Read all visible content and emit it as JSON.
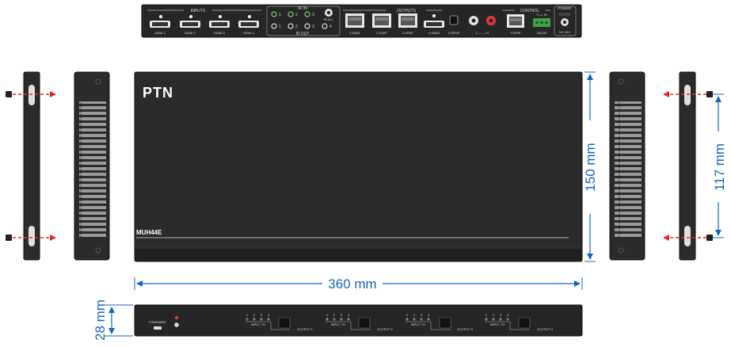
{
  "brand": "PTN",
  "model": "MUH44E",
  "dimensions": {
    "width": "360 mm",
    "depth": "150 mm",
    "height": "28 mm",
    "mount_spacing": "117 mm"
  },
  "rear_panel": {
    "inputs_group": "INPUTS",
    "inputs": [
      "HDMI 1",
      "HDMI 2",
      "HDMI 3",
      "HDMI 4"
    ],
    "ir_in_label": "IR IN",
    "ir_out_label": "IR OUT",
    "ir_numbers": [
      "1",
      "2",
      "3",
      "4"
    ],
    "ir_all": "IR ALL",
    "outputs_group": "OUTPUTS",
    "outputs": [
      "1 HDBT",
      "2 HDBT",
      "3 HDBT",
      "4 HDMI"
    ],
    "spdif": "4 SPDIF",
    "audio_lr": "L — — R",
    "control_group": "CONTROL",
    "tcpip": "TCP/IP",
    "rs232": "RS232",
    "rs232_pins": "Tx  ⏚  Rx",
    "power_group": "POWER",
    "dc": "DC 24V"
  },
  "front_panel": {
    "firmware": "FIRMWARE",
    "led_numbers": [
      "1",
      "2",
      "3",
      "4"
    ],
    "input_to": "INPUT TO",
    "outputs": [
      "OUTPUT 1",
      "OUTPUT 2",
      "OUTPUT 3",
      "OUTPUT 4"
    ]
  },
  "colors": {
    "device": "#262626",
    "dimension_lines": "#1565c0",
    "arrows": "#d32f2f",
    "led_green": "#43a047",
    "led_red": "#e53935"
  }
}
